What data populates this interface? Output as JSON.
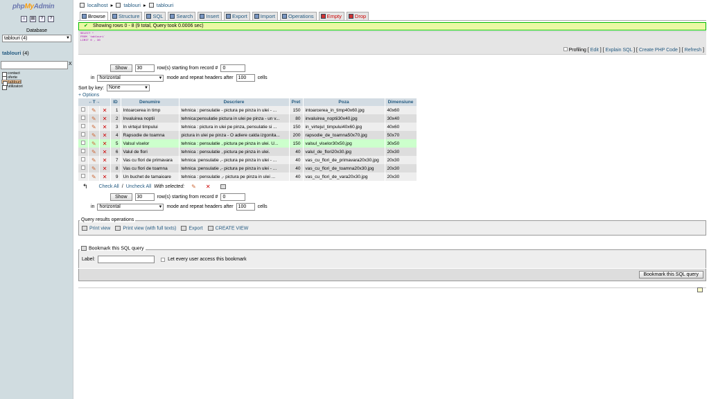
{
  "sidebar": {
    "logo": {
      "php": "php",
      "my": "My",
      "admin": "Admin"
    },
    "icons": [
      "home-icon",
      "query-window-icon",
      "docs-icon",
      "sql-docs-icon"
    ],
    "database_label": "Database",
    "database_value": "tablouri (4)",
    "db_title": "tablouri",
    "db_count": "(4)",
    "filter_clear": "X",
    "tables": [
      "contact",
      "oferte",
      "tablouri",
      "utilizatori"
    ],
    "selected_table": "tablouri"
  },
  "breadcrumb": {
    "server": "localhost",
    "database": "tablouri",
    "table": "tablouri"
  },
  "tabs": [
    {
      "label": "Browse",
      "active": true
    },
    {
      "label": "Structure"
    },
    {
      "label": "SQL"
    },
    {
      "label": "Search"
    },
    {
      "label": "Insert"
    },
    {
      "label": "Export"
    },
    {
      "label": "Import"
    },
    {
      "label": "Operations"
    },
    {
      "label": "Empty",
      "danger": true
    },
    {
      "label": "Drop",
      "danger": true
    }
  ],
  "message": "Showing rows 0 - 8 (9 total, Query took 0.0006 sec)",
  "sql": {
    "line1": "SELECT *",
    "line2": "FROM `tablouri`",
    "line3": "LIMIT 0 , 30"
  },
  "sql_links": {
    "profiling": "Profiling",
    "edit": "Edit",
    "explain": "Explain SQL",
    "php": "Create PHP Code",
    "refresh": "Refresh"
  },
  "nav": {
    "show_label": "Show",
    "rows_value": "30",
    "rows_label": "row(s) starting from record #",
    "start_value": "0",
    "in_label": "in",
    "mode_value": "horizontal",
    "mode_label": "mode and repeat headers after",
    "headers_value": "100",
    "cells_label": "cells"
  },
  "sort": {
    "label": "Sort by key:",
    "value": "None"
  },
  "options_label": "+ Options",
  "table": {
    "headers": [
      "←T→",
      "",
      "",
      "ID",
      "Denumire",
      "Descriere",
      "Pret",
      "Poza",
      "Dimensiune"
    ],
    "rows": [
      [
        "1",
        "Intoarcerea in timp",
        "tehnica : pensulatie - pictura pe pinza in ulei - ...",
        "150",
        "intoarcerea_in_timp40x60.jpg",
        "40x60"
      ],
      [
        "2",
        "Invaluirea noptii",
        "tehnica:pensulatie pictura in ulei pe pinza - un v...",
        "80",
        "invaluirea_noptii30x40.jpg",
        "30x40"
      ],
      [
        "3",
        "In virtejul timpului",
        "tehnica : pictura in ulei pe pinza, pensulatie si ...",
        "150",
        "in_virtejul_timpului40x60.jpg",
        "40x60"
      ],
      [
        "4",
        "Rapsodie de toamna",
        "pictura in ulei pe pinza - O adiere calda izgonita...",
        "200",
        "rapsodie_de_toamna50x70.jpg",
        "50x70"
      ],
      [
        "5",
        "Valsul viselor",
        "tehnica : pensulatie , pictura pe pinza in ulei. U...",
        "150",
        "valsul_viselor30x50.jpg",
        "30x50"
      ],
      [
        "6",
        "Valul de flori",
        "tehnica : pensulatie , pictura pe pinza in ulei.",
        "40",
        "valul_de_flori20x30.jpg",
        "20x30"
      ],
      [
        "7",
        "Vas cu flori de primavara",
        "tehnica :pensulatie ,- pictura pe pinza in ulei - ...",
        "40",
        "vas_cu_flori_de_primavara20x30.jpg",
        "20x30"
      ],
      [
        "8",
        "Vas cu flori de toamna",
        "tehnica :pensulatie ,- pictura pe pinza in ulei - ...",
        "40",
        "vas_cu_flori_de_toamna20x30.jpg",
        "20x30"
      ],
      [
        "9",
        "Un buchet de tamaioare",
        "tehnica : pensulatie ,- pictura pe pinza in ulei ...",
        "40",
        "vas_cu_flori_de_vara20x30.jpg",
        "20x30"
      ]
    ]
  },
  "with_selected": {
    "check_all": "Check All",
    "sep": " / ",
    "uncheck_all": "Uncheck All",
    "label": "With selected:"
  },
  "query_ops": {
    "legend": "Query results operations",
    "print": "Print view",
    "print_full": "Print view (with full texts)",
    "export": "Export",
    "create_view": "CREATE VIEW"
  },
  "bookmark": {
    "legend": "Bookmark this SQL query",
    "label": "Label:",
    "checkbox_label": "Let every user access this bookmark",
    "button": "Bookmark this SQL query"
  },
  "colors": {
    "sidebar_bg": "#d0dce0",
    "header_bg": "#d3dce3",
    "link": "#235a81",
    "highlight": "#ccffcc",
    "selected_table": "#ffcc99"
  }
}
